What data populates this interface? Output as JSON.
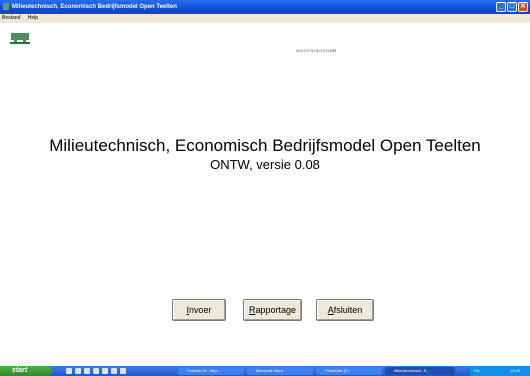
{
  "window": {
    "title": "Milieutechnisch, Economisch Bedrijfsmodel Open Teelten",
    "controls": [
      "_",
      "□",
      "✕"
    ]
  },
  "menu": {
    "items": [
      "Bestand",
      "Help"
    ]
  },
  "logo": {
    "text_prefix": "WAGENINGEN",
    "text_suffix": "UR"
  },
  "content": {
    "title": "Milieutechnisch, Economisch Bedrijfsmodel Open Teelten",
    "version": "ONTW, versie 0.08"
  },
  "buttons": {
    "invoer": {
      "accel": "I",
      "rest": "nvoer"
    },
    "rapportage": {
      "accel": "R",
      "rest": "apportage"
    },
    "afsluiten": {
      "accel": "A",
      "rest": "fsluiten"
    }
  },
  "taskbar": {
    "start": "start",
    "tasks": [
      {
        "label": "Postvak IN - Micr..."
      },
      {
        "label": "Microsoft Word"
      },
      {
        "label": "FlashDisk (F:)"
      },
      {
        "label": "Milieutechnisch, E..."
      }
    ],
    "tray": {
      "lang": "EN",
      "time": "12:09"
    }
  }
}
